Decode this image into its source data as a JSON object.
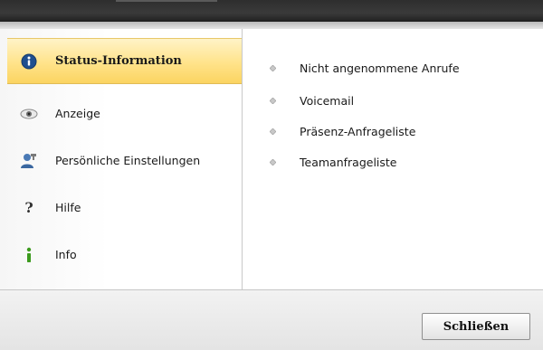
{
  "sidebar": {
    "items": [
      {
        "label": "Status-Information",
        "icon": "info-circle-icon",
        "active": true
      },
      {
        "label": "Anzeige",
        "icon": "eye-icon",
        "active": false
      },
      {
        "label": "Persönliche Einstellungen",
        "icon": "user-settings-icon",
        "active": false
      },
      {
        "label": "Hilfe",
        "icon": "question-mark-icon",
        "active": false
      },
      {
        "label": "Info",
        "icon": "info-i-icon",
        "active": false
      }
    ]
  },
  "content": {
    "links": [
      {
        "label": "Nicht angenommene Anrufe"
      },
      {
        "label": "Voicemail"
      },
      {
        "label": "Präsenz-Anfrageliste"
      },
      {
        "label": "Teamanfrageliste"
      }
    ]
  },
  "footer": {
    "close_label": "Schließen"
  },
  "colors": {
    "active_highlight": "#ffe38a",
    "info_icon_blue": "#1f4f8f",
    "info_i_green": "#3c9a1e"
  }
}
